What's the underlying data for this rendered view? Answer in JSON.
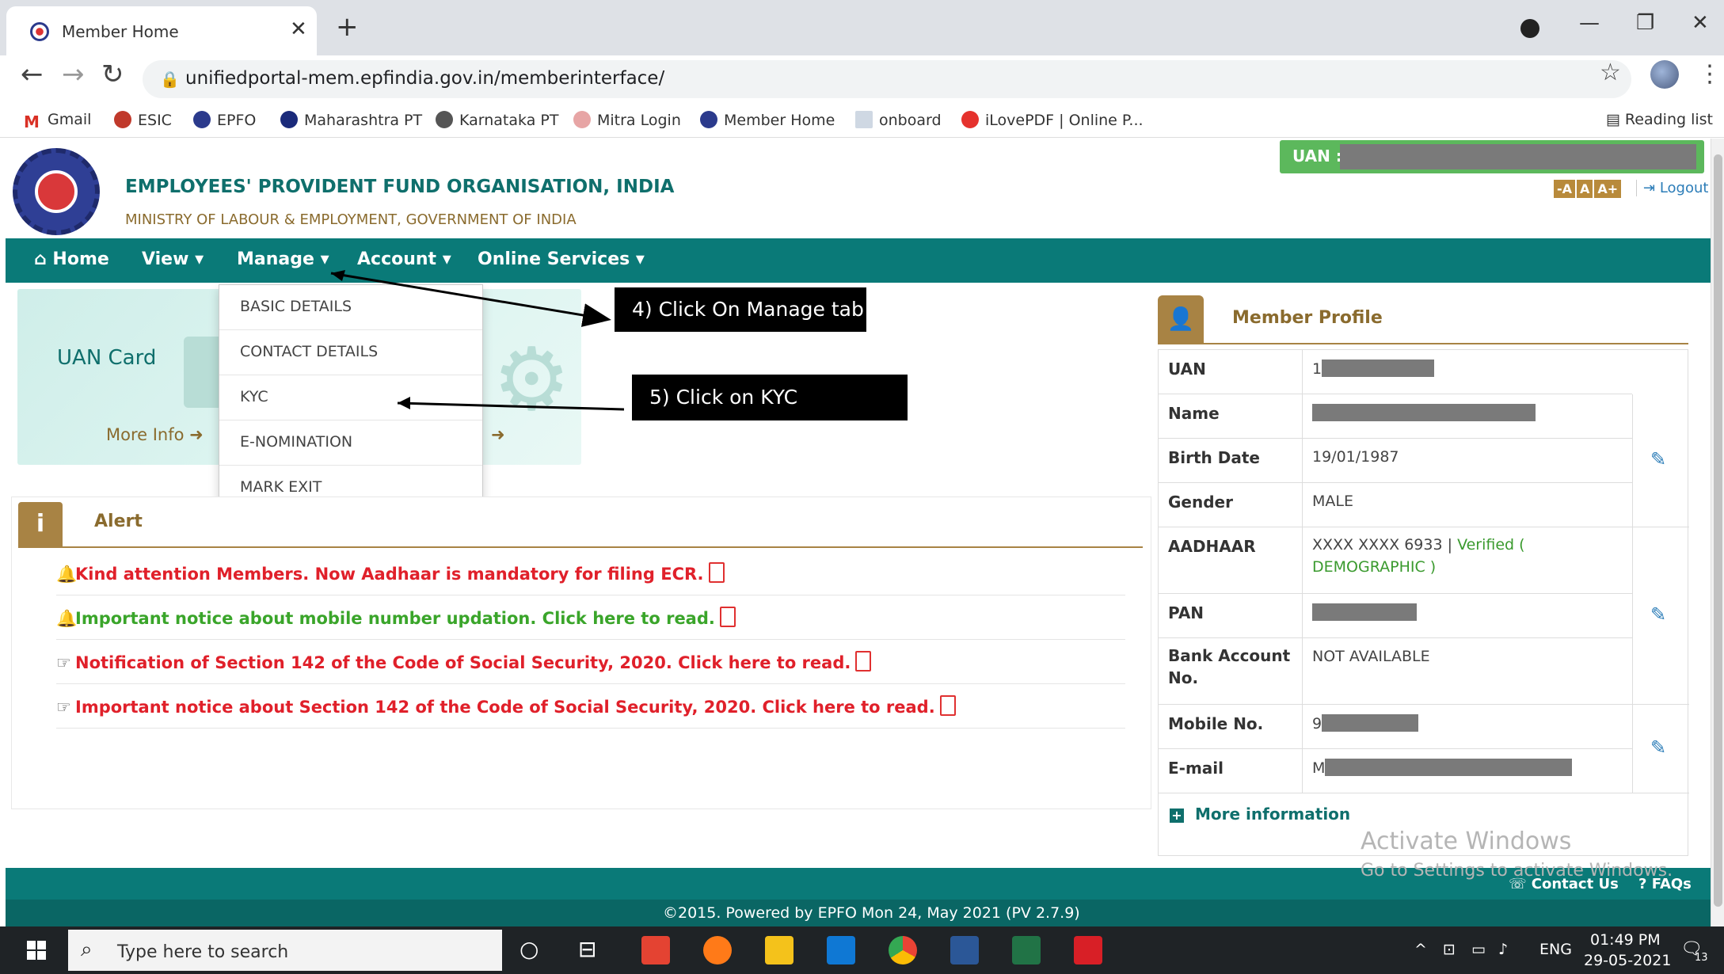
{
  "browser": {
    "tab_title": "Member Home",
    "url": "unifiedportal-mem.epfindia.gov.in/memberinterface/",
    "bookmarks": [
      "Gmail",
      "ESIC",
      "EPFO",
      "Maharashtra PT",
      "Karnataka PT",
      "Mitra Login",
      "Member Home",
      "onboard",
      "iLovePDF | Online P..."
    ],
    "reading_list": "Reading list"
  },
  "header": {
    "org_title": "EMPLOYEES' PROVIDENT FUND ORGANISATION, INDIA",
    "org_subtitle": "MINISTRY OF LABOUR & EMPLOYMENT, GOVERNMENT OF INDIA",
    "uan_label": "UAN :",
    "font_buttons": [
      "-A",
      "A",
      "A+"
    ],
    "logout": "Logout"
  },
  "menu": [
    "Home",
    "View",
    "Manage",
    "Account",
    "Online Services"
  ],
  "dropdown": [
    "BASIC DETAILS",
    "CONTACT DETAILS",
    "KYC",
    "E-NOMINATION",
    "MARK EXIT"
  ],
  "uan_card": {
    "title": "UAN Card",
    "more_info": "More Info"
  },
  "annotations": [
    "4) Click On Manage tab",
    "5) Click on KYC"
  ],
  "alert": {
    "title": "Alert",
    "items": [
      {
        "text": "Kind attention Members. Now Aadhaar is mandatory for filing ECR.",
        "color": "#e0202a",
        "icon": "bell-icon"
      },
      {
        "text": "Important notice about mobile number updation. Click here to read.",
        "color": "#3aa52a",
        "icon": "bell-icon"
      },
      {
        "text": "Notification of Section 142 of the Code of Social Security, 2020. Click here to read.",
        "color": "#e0202a",
        "icon": "pointing-hand-icon"
      },
      {
        "text": "Important notice about Section 142 of the Code of Social Security, 2020. Click here to read.",
        "color": "#e0202a",
        "icon": "pointing-hand-icon"
      }
    ]
  },
  "profile": {
    "title": "Member Profile",
    "rows": [
      {
        "label": "UAN",
        "value": "1"
      },
      {
        "label": "Name",
        "value": ""
      },
      {
        "label": "Birth Date",
        "value": "19/01/1987"
      },
      {
        "label": "Gender",
        "value": "MALE"
      },
      {
        "label": "AADHAAR",
        "value": "XXXX XXXX 6933 |",
        "verified": "Verified ( DEMOGRAPHIC )"
      },
      {
        "label": "PAN",
        "value": ""
      },
      {
        "label": "Bank Account No.",
        "value": "NOT AVAILABLE"
      },
      {
        "label": "Mobile No.",
        "value": "9"
      },
      {
        "label": "E-mail",
        "value": "M"
      }
    ],
    "more_information": "More information"
  },
  "watermark": {
    "line1": "Activate Windows",
    "line2": "Go to Settings to activate Windows."
  },
  "footer": {
    "contact": "Contact Us",
    "faqs": "FAQs",
    "copyright": "©2015. Powered by EPFO Mon 24, May 2021 (PV 2.7.9)"
  },
  "taskbar": {
    "search_placeholder": "Type here to search",
    "lang": "ENG",
    "time": "01:49 PM",
    "date": "29-05-2021",
    "notifications": "13"
  },
  "colors": {
    "teal": "#0a7a78",
    "gold": "#a88344",
    "alert_red": "#e0202a",
    "alert_green": "#3aa52a"
  }
}
